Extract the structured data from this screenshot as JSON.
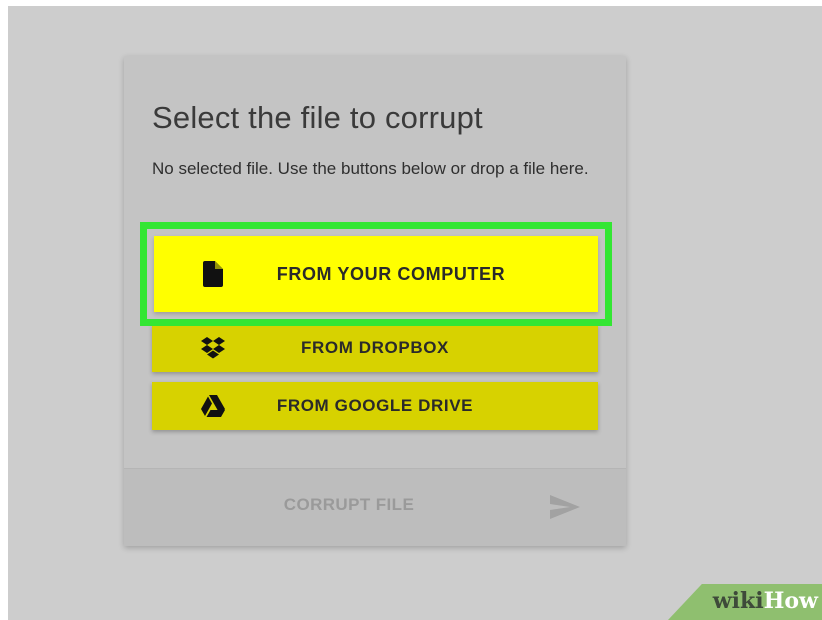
{
  "card": {
    "title": "Select the file to corrupt",
    "description": "No selected file. Use the buttons below or drop a file here."
  },
  "sources": {
    "computer": {
      "label": "FROM YOUR COMPUTER",
      "icon": "file-icon"
    },
    "dropbox": {
      "label": "FROM DROPBOX",
      "icon": "dropbox-icon"
    },
    "drive": {
      "label": "FROM GOOGLE DRIVE",
      "icon": "google-drive-icon"
    }
  },
  "footer": {
    "corrupt_label": "CORRUPT FILE",
    "send_icon": "send-icon"
  },
  "watermark": {
    "part1": "wiki",
    "part2": "How"
  },
  "colors": {
    "background": "#cdcdcd",
    "card": "#c4c4c4",
    "button": "#d7d200",
    "highlighted_button": "#ffff00",
    "highlight_border": "#33e633",
    "disabled_text": "#9a9a9a"
  }
}
